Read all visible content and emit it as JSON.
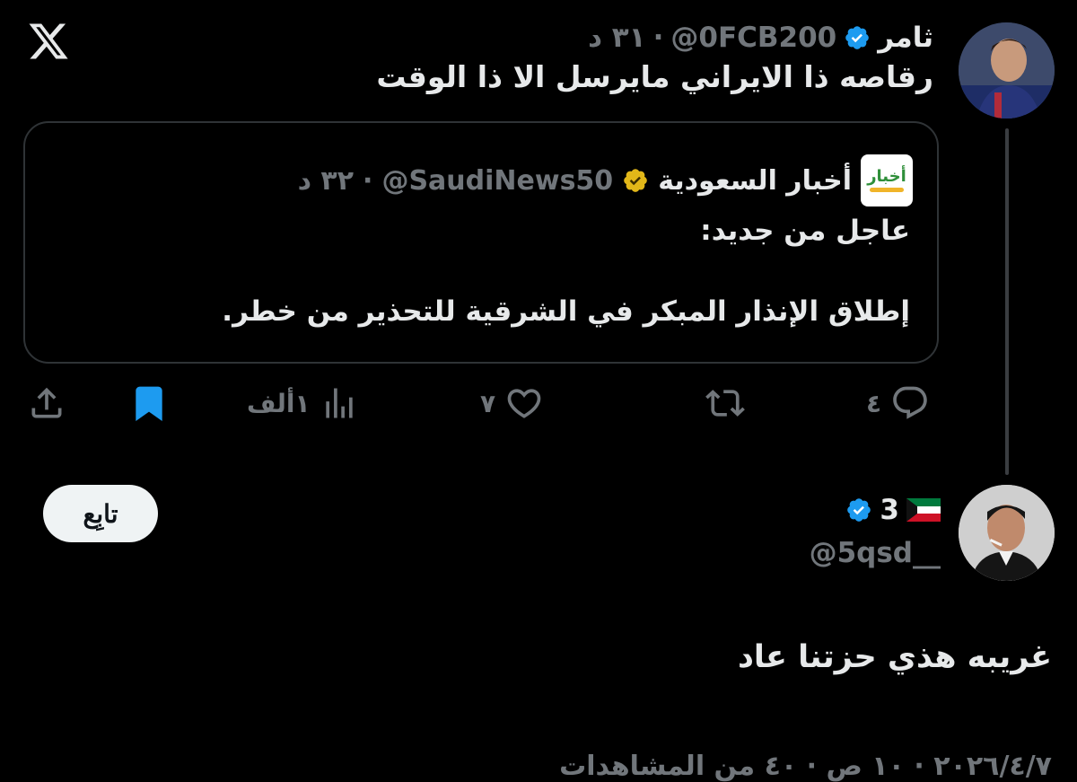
{
  "colors": {
    "background": "#000000",
    "text": "#e7e9ea",
    "muted": "#71767b",
    "verified_blue": "#1d9bf0",
    "verified_gold": "#e2b719",
    "bookmark_blue": "#1d9bf0",
    "border": "#2f3336"
  },
  "app": {
    "logo_icon": "x-logo-icon"
  },
  "tweet": {
    "author_name": "ثامر",
    "handle": "@0FCB200",
    "separator": "·",
    "time": "٣١ د",
    "text": "رقاصه ذا الايراني مايرسل الا ذا الوقت",
    "quote": {
      "author_name": "أخبار السعودية",
      "handle": "@SaudiNews50",
      "separator": "·",
      "time": "٣٢ د",
      "logo_text": "أخبار",
      "line1": "عاجل من جديد:",
      "line2": "إطلاق الإنذار المبكر في الشرقية للتحذير من خطر."
    },
    "actions": {
      "replies": "٤",
      "retweets": "",
      "likes": "٧",
      "views": "١ألف"
    }
  },
  "reply": {
    "author_name": "3",
    "handle": "@5qsd__",
    "follow_label": "تابِع",
    "text": "غريبه هذي حزتنا عاد",
    "meta": "٢٠٢٦/٤/٧ · ١٠ ص · ٤٠ من المشاهدات"
  }
}
